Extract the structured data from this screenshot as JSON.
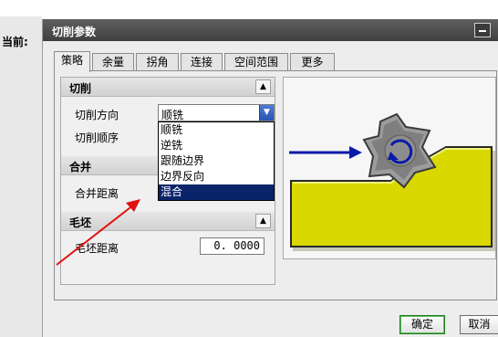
{
  "background": {
    "label": "当前:"
  },
  "dialog": {
    "title": "切削参数",
    "tabs": [
      {
        "label": "策略",
        "active": true
      },
      {
        "label": "余量"
      },
      {
        "label": "拐角"
      },
      {
        "label": "连接"
      },
      {
        "label": "空间范围"
      },
      {
        "label": "更多"
      }
    ],
    "sections": {
      "cutting": {
        "title": "切削",
        "direction_label": "切削方向",
        "direction_value": "顺铣",
        "order_label": "切削顺序",
        "options": [
          "顺铣",
          "逆铣",
          "跟随边界",
          "边界反向",
          "混合"
        ],
        "highlighted_option": "混合"
      },
      "merge": {
        "title": "合并",
        "distance_label": "合并距离"
      },
      "blank": {
        "title": "毛坯",
        "distance_label": "毛坯距离",
        "distance_value": "0. 0000"
      }
    },
    "buttons": {
      "ok": "确定",
      "cancel": "取消"
    }
  },
  "colors": {
    "titlebar": "#4a4a4a",
    "selection": "#0a246a",
    "preview_block": "#d9d800",
    "tool_arrow": "#0a1aa8",
    "annotation_arrow": "#e01010"
  }
}
